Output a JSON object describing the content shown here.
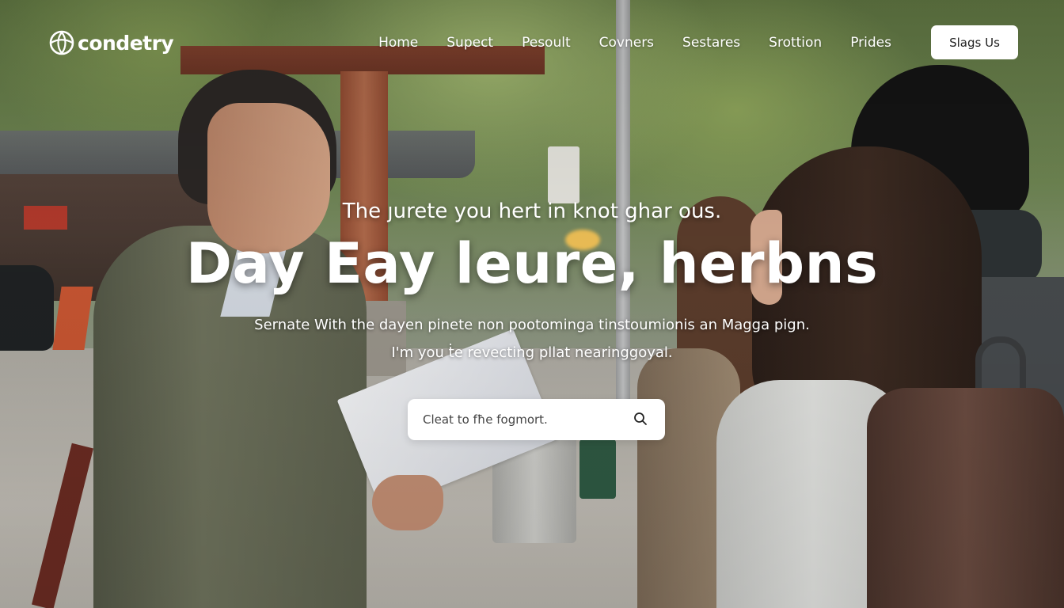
{
  "brand": {
    "name": "condetry",
    "icon": "globe-leaf-icon"
  },
  "nav": {
    "items": [
      {
        "label": "Home"
      },
      {
        "label": "Supect"
      },
      {
        "label": "Pesoult"
      },
      {
        "label": "Covners"
      },
      {
        "label": "Sestares"
      },
      {
        "label": "Srottion"
      },
      {
        "label": "Prides"
      }
    ],
    "cta_label": "Slags Us"
  },
  "hero": {
    "tagline": "The ȷurete you hert in knot ghar ous.",
    "headline": "Day Eay leure, herbns",
    "subtitle_line1": "Sernate With the dayen pinete non pootominga tinstoumionis an Magga pign.",
    "subtitle_line2": "I'm you ṫe revecting pllat nearinggoyal."
  },
  "search": {
    "placeholder": "Cleat to fħe fogmort.",
    "icon": "search-icon"
  },
  "colors": {
    "text_on_photo": "#ffffff",
    "button_bg": "#ffffff",
    "button_text": "#222222"
  }
}
